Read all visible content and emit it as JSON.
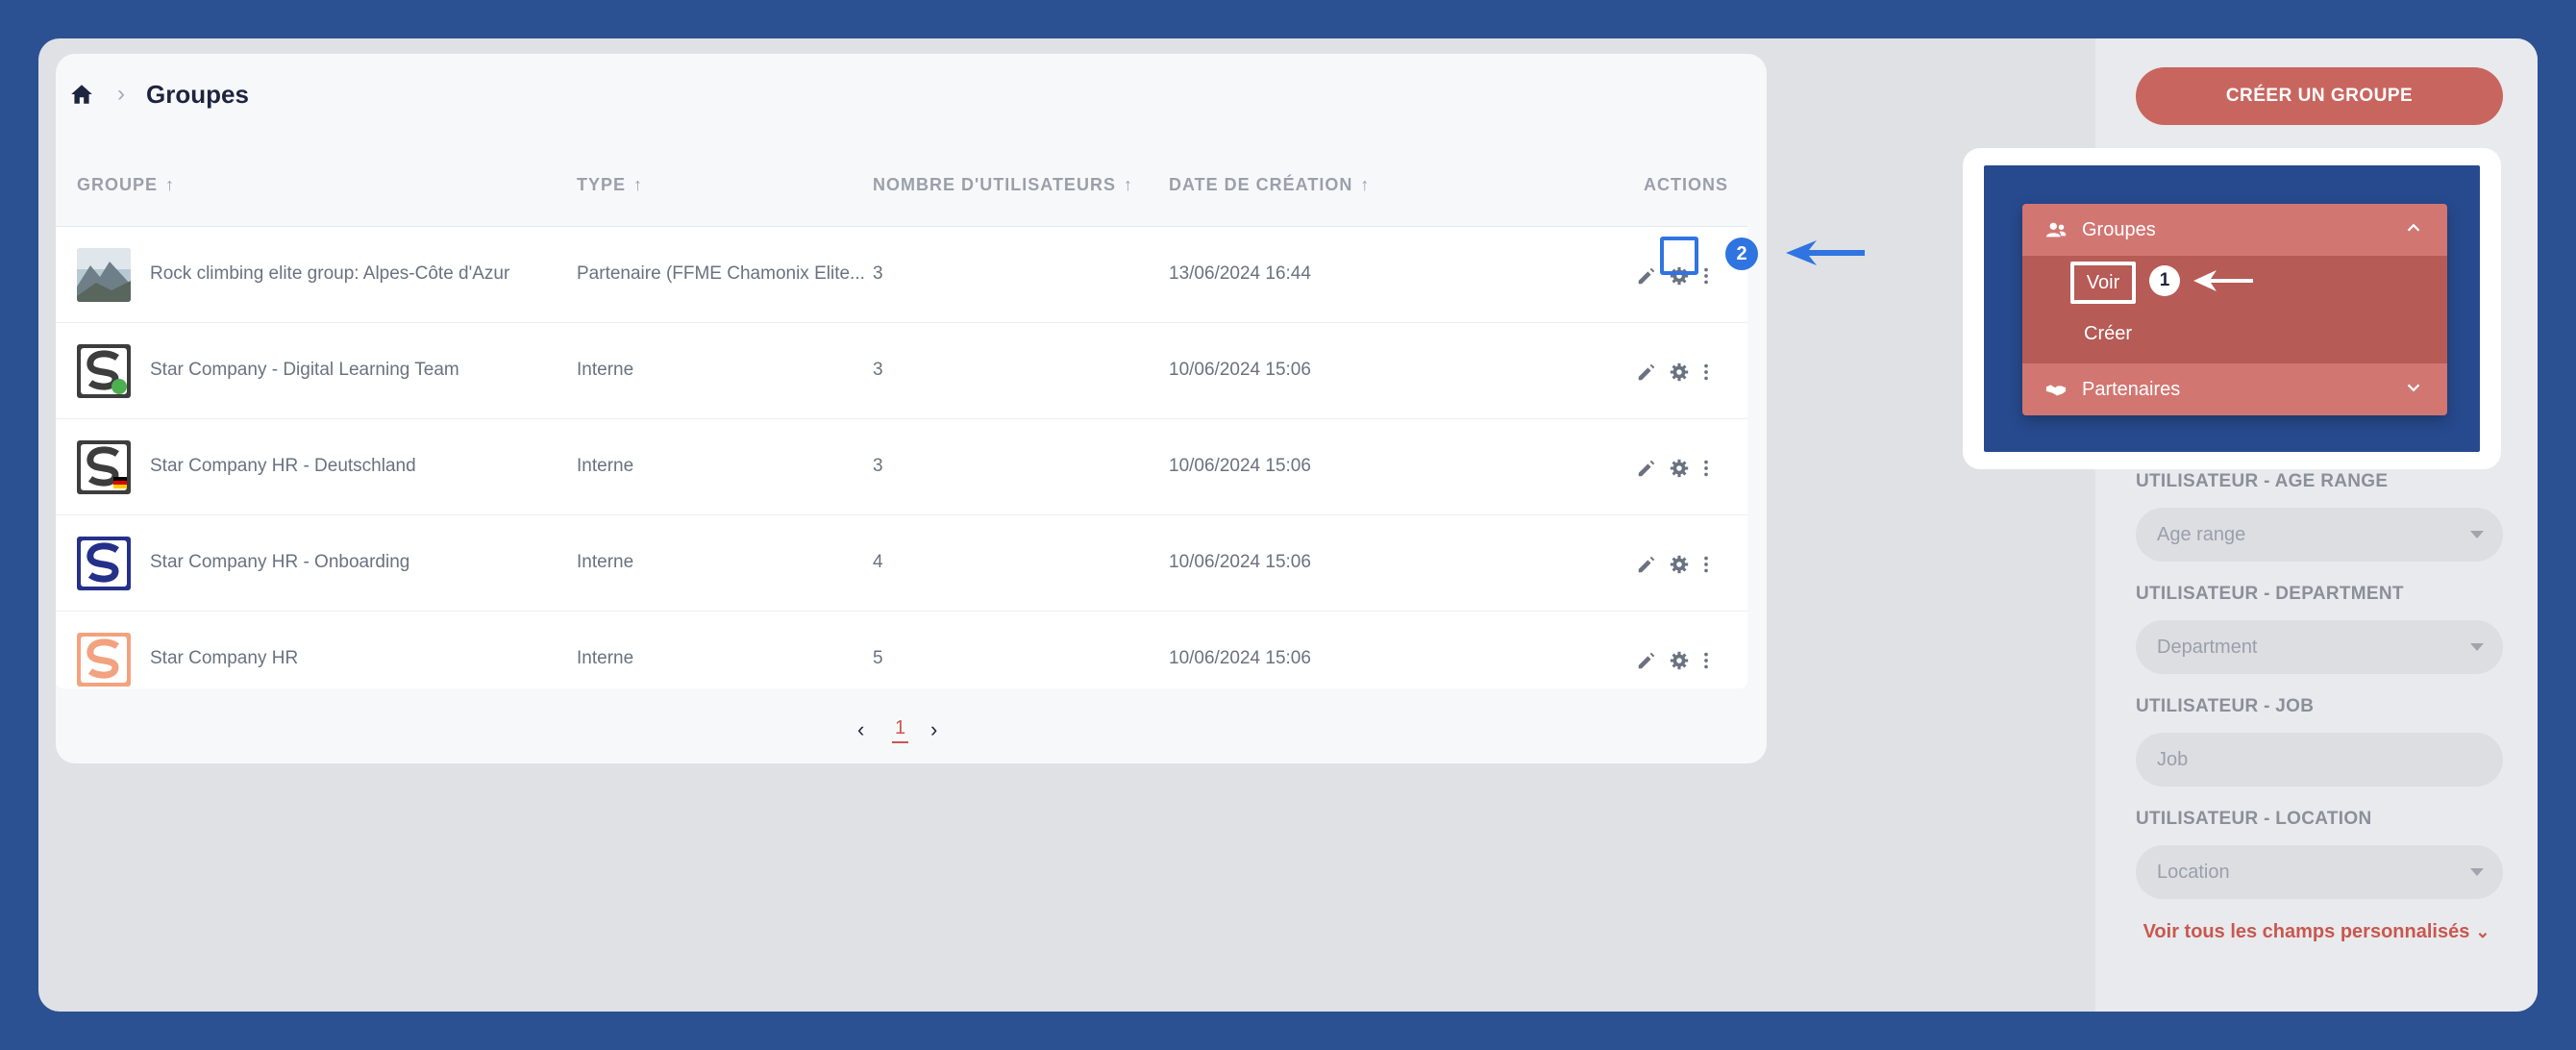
{
  "breadcrumb": {
    "home_icon": "home-icon",
    "title": "Groupes"
  },
  "table": {
    "headers": {
      "group": "GROUPE",
      "type": "TYPE",
      "users": "NOMBRE D'UTILISATEURS",
      "created": "DATE DE CRÉATION",
      "actions": "ACTIONS"
    },
    "sort_arrow": "↑",
    "rows": [
      {
        "name": "Rock climbing elite group: Alpes-Côte d'Azur",
        "type": "Partenaire (FFME Chamonix Elite...",
        "users": "3",
        "created": "13/06/2024 16:44"
      },
      {
        "name": "Star Company - Digital Learning Team",
        "type": "Interne",
        "users": "3",
        "created": "10/06/2024 15:06"
      },
      {
        "name": "Star Company HR - Deutschland",
        "type": "Interne",
        "users": "3",
        "created": "10/06/2024 15:06"
      },
      {
        "name": "Star Company HR - Onboarding",
        "type": "Interne",
        "users": "4",
        "created": "10/06/2024 15:06"
      },
      {
        "name": "Star Company HR",
        "type": "Interne",
        "users": "5",
        "created": "10/06/2024 15:06"
      }
    ]
  },
  "pagination": {
    "current": "1",
    "prev": "‹",
    "next": "›"
  },
  "sidebar": {
    "create_button": "CRÉER UN GROUPE",
    "filters": [
      {
        "label": "UTILISATEUR - AGE RANGE",
        "placeholder": "Age range",
        "has_caret": true
      },
      {
        "label": "UTILISATEUR - DEPARTMENT",
        "placeholder": "Department",
        "has_caret": true
      },
      {
        "label": "UTILISATEUR - JOB",
        "placeholder": "Job",
        "has_caret": false
      },
      {
        "label": "UTILISATEUR - LOCATION",
        "placeholder": "Location",
        "has_caret": true
      }
    ],
    "more_link": "Voir tous les champs personnalisés"
  },
  "callouts": {
    "step1": "1",
    "step2": "2",
    "menu": {
      "groups_label": "Groupes",
      "voir_label": "Voir",
      "creer_label": "Créer",
      "partners_label": "Partenaires"
    }
  },
  "colors": {
    "background": "#2c5193",
    "accent": "#c9655f",
    "highlight": "#2f74e0"
  }
}
